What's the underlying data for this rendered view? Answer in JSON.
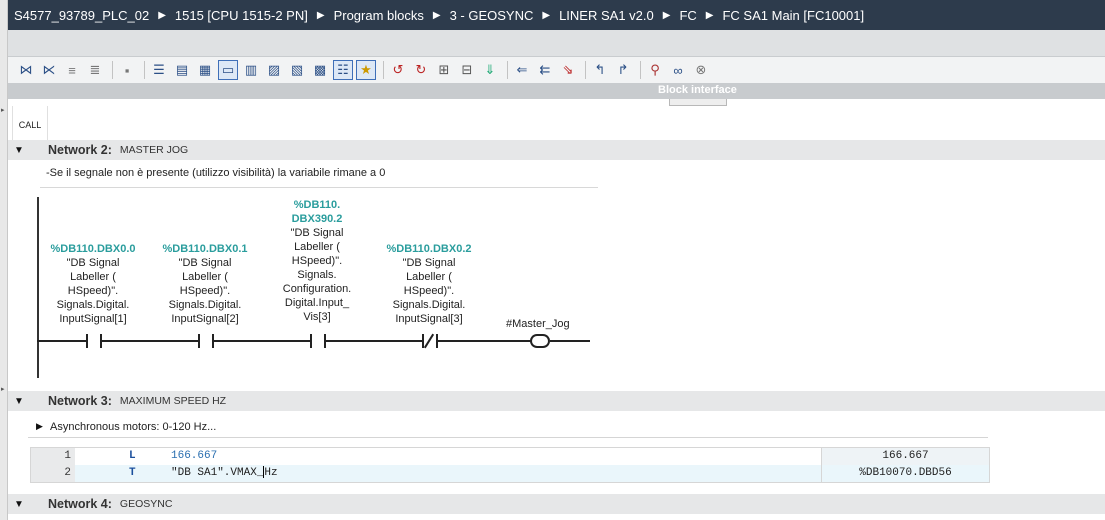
{
  "breadcrumb": [
    "S4577_93789_PLC_02",
    "1515 [CPU 1515-2 PN]",
    "Program blocks",
    "3 - GEOSYNC",
    "LINER SA1 v2.0",
    "FC",
    "FC SA1 Main [FC10001]"
  ],
  "toolbar": {
    "icons": [
      "insert-network-icon",
      "delete-network-icon",
      "insert-row-icon",
      "add-row-icon",
      "toggle-absolute-icon",
      "expand-icon",
      "collapse-icon",
      "networks-icon",
      "comments-icon",
      "favorites-icon",
      "display-options-icon",
      "monitor-icon",
      "abs-symbolic-icon",
      "list-view-icon",
      "favorites-bar-icon",
      "go-to-icon",
      "go-back-icon",
      "load-icon",
      "compare-icon",
      "download-icon",
      "jump-prev-icon",
      "jump-next-icon",
      "jump-in-icon",
      "jump-out-icon",
      "monitoring-icon",
      "watch-icon",
      "module-icon"
    ]
  },
  "block_interface": {
    "label": "Block interface"
  },
  "call_tab": {
    "label": "CALL"
  },
  "networks": [
    {
      "label": "Network 2:",
      "title": "MASTER JOG",
      "comment": "-Se il segnale non è presente (utilizzo visibilità) la variabile rimane a 0",
      "contacts": [
        {
          "addr": "%DB110.DBX0.0",
          "symbol": [
            "\"DB Signal",
            "Labeller (",
            "HSpeed)\".",
            "Signals.Digital.",
            "InputSignal[1]"
          ],
          "type": "NO"
        },
        {
          "addr": "%DB110.DBX0.1",
          "symbol": [
            "\"DB Signal",
            "Labeller (",
            "HSpeed)\".",
            "Signals.Digital.",
            "InputSignal[2]"
          ],
          "type": "NO"
        },
        {
          "addr": [
            "%DB110.",
            "DBX390.2"
          ],
          "symbol": [
            "\"DB Signal",
            "Labeller (",
            "HSpeed)\".",
            "Signals.",
            "Configuration.",
            "Digital.Input_",
            "Vis[3]"
          ],
          "type": "NO"
        },
        {
          "addr": "%DB110.DBX0.2",
          "symbol": [
            "\"DB Signal",
            "Labeller (",
            "HSpeed)\".",
            "Signals.Digital.",
            "InputSignal[3]"
          ],
          "type": "NC"
        }
      ],
      "coil": "#Master_Jog"
    },
    {
      "label": "Network 3:",
      "title": "MAXIMUM SPEED HZ",
      "sub_comment": "Asynchronous motors: 0-120 Hz...",
      "stl": [
        {
          "line": "1",
          "op": "L",
          "arg": "166.667",
          "value": "166.667"
        },
        {
          "line": "2",
          "op": "T",
          "arg_before": "\"DB SA1\".VMAX_",
          "arg_after": "Hz",
          "value": "%DB10070.DBD56"
        }
      ]
    },
    {
      "label": "Network 4:",
      "title": "GEOSYNC"
    }
  ],
  "colors": {
    "titlebar": "#2d3b4c",
    "address": "#2a9d9d",
    "stl_op": "#1b4f9c"
  }
}
